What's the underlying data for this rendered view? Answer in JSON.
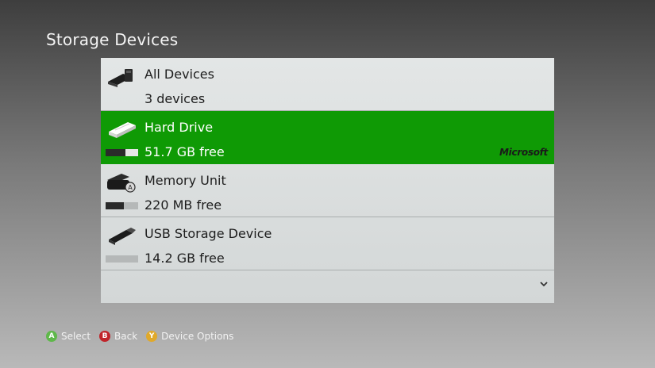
{
  "page": {
    "title": "Storage Devices"
  },
  "devices": [
    {
      "name": "All Devices",
      "sub": "3 devices",
      "icon": "all-devices-icon"
    },
    {
      "name": "Hard Drive",
      "sub": "51.7 GB free",
      "icon": "hard-drive-icon",
      "used_fraction": 0.62,
      "brand": "Microsoft",
      "selected": true
    },
    {
      "name": "Memory Unit",
      "sub": "220 MB free",
      "icon": "memory-unit-icon",
      "used_fraction": 0.55
    },
    {
      "name": "USB Storage Device",
      "sub": "14.2 GB free",
      "icon": "usb-drive-icon",
      "used_fraction": 0.0
    }
  ],
  "scroll": {
    "icon": "chevron-down-icon"
  },
  "footer": {
    "hints": [
      {
        "button": "A",
        "label": "Select",
        "color": "#5fb84a"
      },
      {
        "button": "B",
        "label": "Back",
        "color": "#c0242a"
      },
      {
        "button": "Y",
        "label": "Device Options",
        "color": "#e0a92a"
      }
    ]
  },
  "colors": {
    "selection": "#0f9a05",
    "panel": "#dcdfdf"
  }
}
